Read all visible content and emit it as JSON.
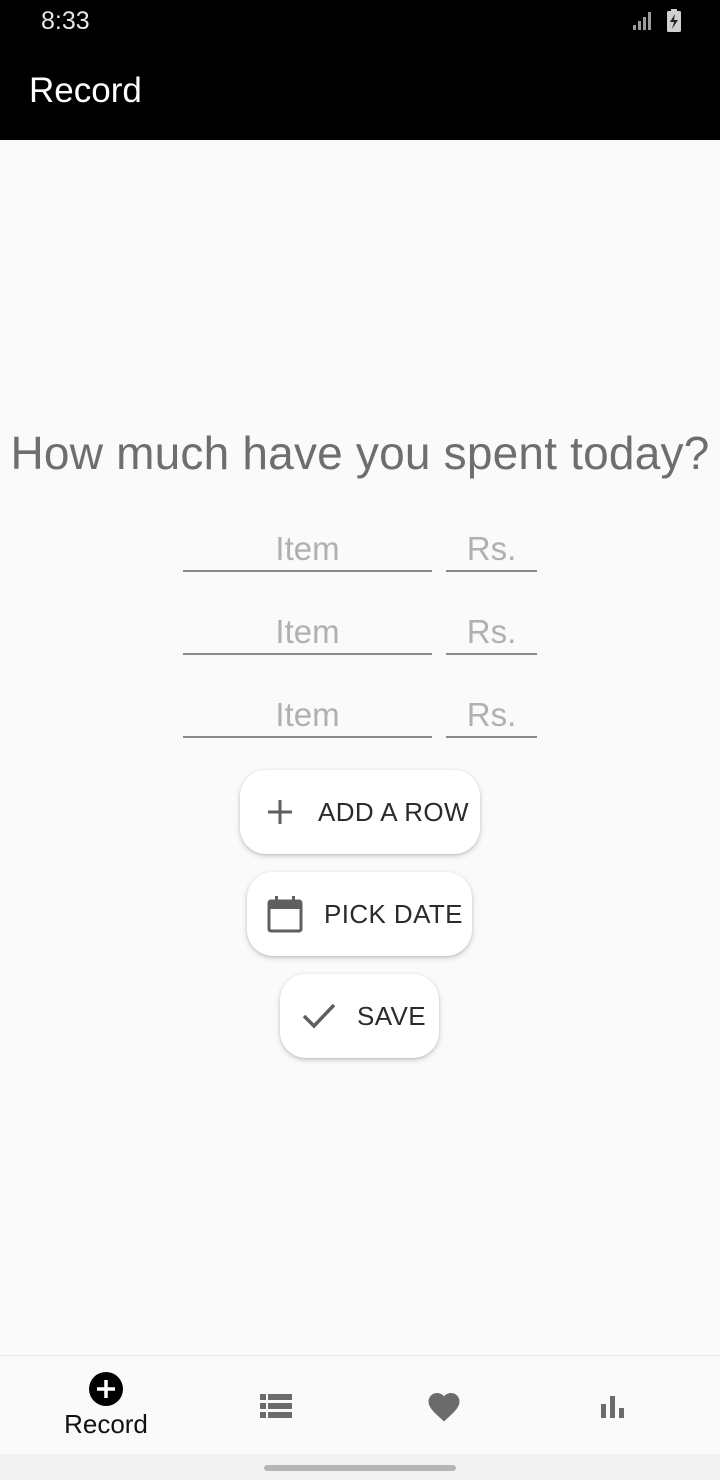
{
  "status_bar": {
    "time": "8:33",
    "icons": [
      "signal-icon",
      "battery-charging-icon"
    ]
  },
  "app_bar": {
    "title": "Record"
  },
  "main": {
    "headline": "How much have you spent today?",
    "rows": [
      {
        "item_placeholder": "Item",
        "price_placeholder": "Rs."
      },
      {
        "item_placeholder": "Item",
        "price_placeholder": "Rs."
      },
      {
        "item_placeholder": "Item",
        "price_placeholder": "Rs."
      }
    ],
    "buttons": {
      "add_row": {
        "label": "ADD A ROW",
        "icon": "plus-icon"
      },
      "pick_date": {
        "label": "PICK DATE",
        "icon": "calendar-icon"
      },
      "save": {
        "label": "SAVE",
        "icon": "check-icon"
      }
    }
  },
  "bottom_nav": {
    "items": [
      {
        "label": "Record",
        "icon": "add-circle-icon",
        "selected": true
      },
      {
        "label": "",
        "icon": "list-icon",
        "selected": false
      },
      {
        "label": "",
        "icon": "heart-icon",
        "selected": false
      },
      {
        "label": "",
        "icon": "bar-chart-icon",
        "selected": false
      }
    ]
  },
  "colors": {
    "app_bar": "#000000",
    "background": "#fafafa",
    "headline": "#6e6e6e",
    "icon": "#6b6b6b"
  }
}
